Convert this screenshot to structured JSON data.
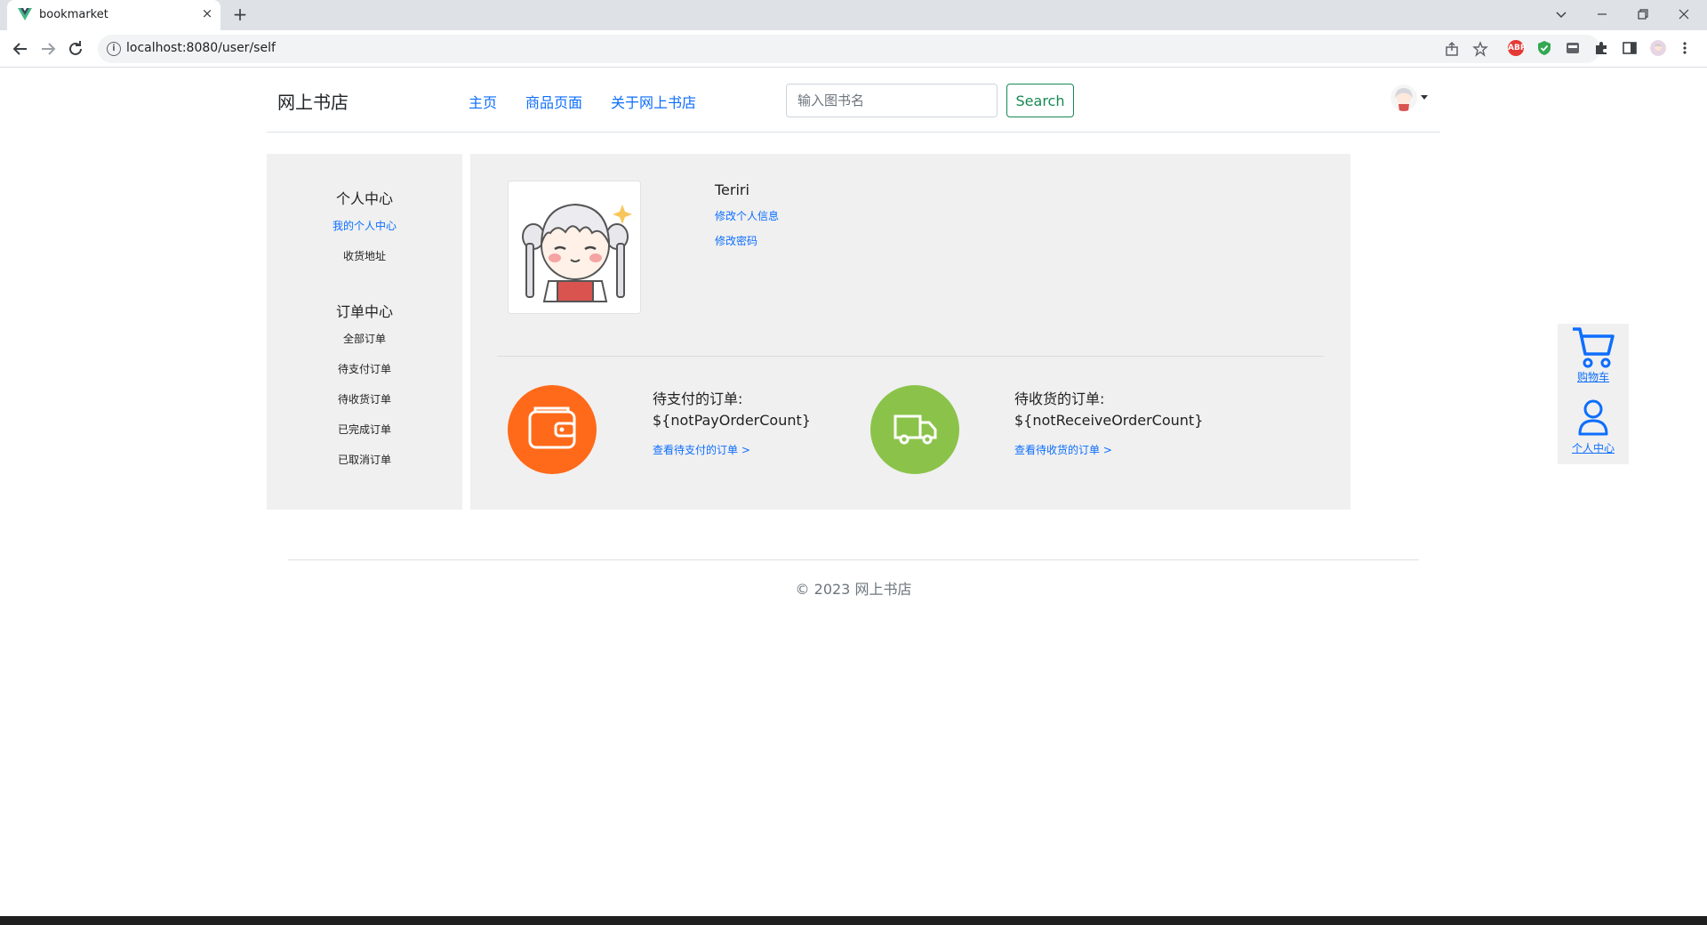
{
  "browser": {
    "tab_title": "bookmarket",
    "url": "localhost:8080/user/self",
    "new_tab_symbol": "+",
    "close_symbol": "×",
    "icons": [
      "back-arrow-icon",
      "forward-arrow-icon",
      "reload-icon",
      "info-icon",
      "share-icon",
      "bookmark-star-icon",
      "adblock-icon",
      "shield-icon",
      "extension-icon",
      "puzzle-icon",
      "sidepanel-icon",
      "profile-avatar-icon",
      "menu-dots-icon"
    ],
    "adblock_label": "ABP"
  },
  "site": {
    "brand": "网上书店",
    "nav_links": [
      "主页",
      "商品页面",
      "关于网上书店"
    ],
    "search_placeholder": "输入图书名",
    "search_button": "Search"
  },
  "sidebar": {
    "section1_title": "个人中心",
    "section1_items": [
      "我的个人中心",
      "收货地址"
    ],
    "section2_title": "订单中心",
    "section2_items": [
      "全部订单",
      "待支付订单",
      "待收货订单",
      "已完成订单",
      "已取消订单"
    ]
  },
  "profile": {
    "username": "Teriri",
    "edit_info": "修改个人信息",
    "change_password": "修改密码"
  },
  "orders": {
    "unpaid_title": "待支付的订单:",
    "unpaid_value": "${notPayOrderCount}",
    "unpaid_link": "查看待支付的订单 >",
    "unreceived_title": "待收货的订单:",
    "unreceived_value": "${notReceiveOrderCount}",
    "unreceived_link": "查看待收货的订单 >"
  },
  "float_panel": {
    "cart_label": "购物车",
    "user_label": "个人中心"
  },
  "footer": {
    "text": "© 2023 网上书店"
  },
  "colors": {
    "link": "#0d6efd",
    "search_green": "#198754",
    "unpaid_orange": "#ff6a1a",
    "unreceived_green": "#8bc34a",
    "panel_gray": "#f0f0f0"
  }
}
